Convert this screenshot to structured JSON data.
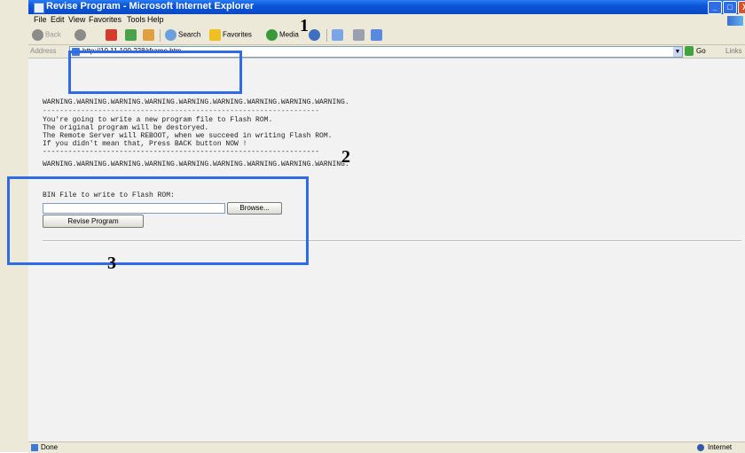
{
  "window": {
    "title": "Revise Program - Microsoft Internet Explorer",
    "controls": {
      "minimize": "_",
      "maximize": "□",
      "close": "X"
    }
  },
  "menubar": {
    "items": [
      "File",
      "Edit",
      "View",
      "Favorites",
      "Tools",
      "Help"
    ]
  },
  "toolbar": {
    "back_label": "Back",
    "search_label": "Search",
    "favorites_label": "Favorites",
    "media_label": "Media"
  },
  "addressbar": {
    "label": "Address",
    "url": "http://10.11.100.228/rframe.htm",
    "go_label": "Go",
    "links_label": "Links"
  },
  "content": {
    "warning_top": "WARNING.WARNING.WARNING.WARNING.WARNING.WARNING.WARNING.WARNING.WARNING.",
    "dash_line": "-----------------------------------------------------------------",
    "message_lines": [
      "You're going to write a new program file to Flash ROM.",
      "The original program will be destoryed.",
      "The Remote Server will REBOOT, when we succeed in writing Flash ROM.",
      "If you didn't mean that, Press BACK button NOW !"
    ],
    "warning_bottom": "WARNING.WARNING.WARNING.WARNING.WARNING.WARNING.WARNING.WARNING.WARNING.",
    "form": {
      "label": "BIN File to write to Flash ROM:",
      "file_value": "",
      "browse_label": "Browse...",
      "submit_label": "Revise Program"
    }
  },
  "statusbar": {
    "status": "Done",
    "zone": "Internet"
  },
  "annotations": {
    "marker_1": "1",
    "marker_2": "2",
    "marker_3": "3",
    "highlight_color": "#2f6be8"
  }
}
